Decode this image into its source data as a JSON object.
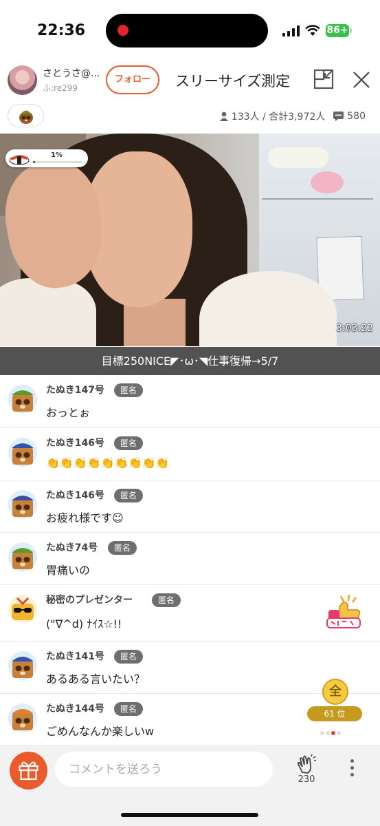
{
  "status_bar": {
    "time": "22:36",
    "battery": "86+"
  },
  "header": {
    "user_name": "さとうさ@...",
    "user_id": "ふ:re299",
    "follow_label": "フォロー",
    "live_title": "スリーサイズ測定"
  },
  "stats": {
    "viewers": "133人 / 合計3,972人",
    "comments": "580"
  },
  "video": {
    "goal_progress_label": "1%",
    "goal_progress_value": 0.01,
    "elapsed": "3:03:22",
    "ticker": "目標250NICE◤･ω･◥仕事復帰→5/7"
  },
  "comments": [
    {
      "name": "たぬき147号",
      "anon": "匿名",
      "text": "おっとぉ"
    },
    {
      "name": "たぬき146号",
      "anon": "匿名",
      "text": "👏👏👏👏👏👏👏👏👏"
    },
    {
      "name": "たぬき146号",
      "anon": "匿名",
      "text": "お疲れ様です☺"
    },
    {
      "name": "たぬき74号",
      "anon": "匿名",
      "text": "胃痛いの"
    },
    {
      "name": "秘密のプレゼンター",
      "anon": "匿名",
      "text": "(\"∇^d) ﾅｲｽ☆!!"
    },
    {
      "name": "たぬき141号",
      "anon": "匿名",
      "text": "あるある言いたい？"
    },
    {
      "name": "たぬき144号",
      "anon": "匿名",
      "text": "ごめんなんか楽しいw"
    }
  ],
  "ranking": {
    "coin": "全",
    "rank": "61 位"
  },
  "bottom_bar": {
    "comment_placeholder": "コメントを送ろう",
    "clap_count": "230"
  },
  "colors": {
    "accent": "#ea5b2b",
    "anon_badge": "#6e6e6e",
    "ticker_bg": "#525252"
  }
}
